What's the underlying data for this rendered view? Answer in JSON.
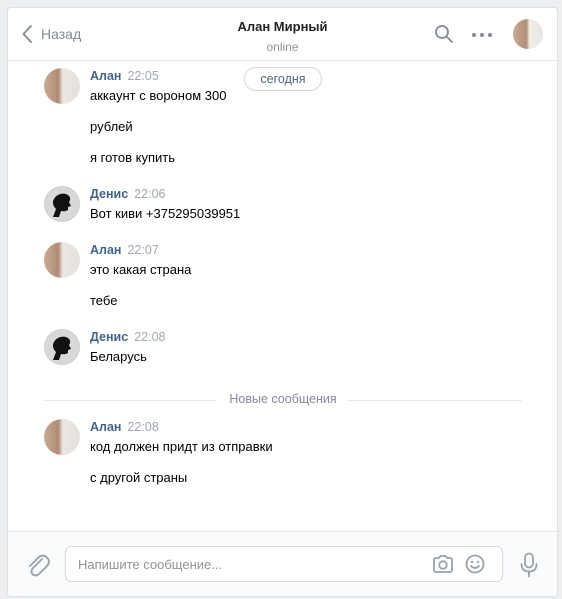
{
  "header": {
    "back_label": "Назад",
    "peer_name": "Алан Мирный",
    "peer_status": "online"
  },
  "date_pill": "сегодня",
  "messages": [
    {
      "author": "Алан",
      "time": "22:05",
      "avatar": "alan-avatar",
      "lines": [
        "аккаунт с вороном 300",
        "рублей",
        "я готов купить"
      ]
    },
    {
      "author": "Денис",
      "time": "22:06",
      "avatar": "denis-avatar",
      "lines": [
        "Вот киви +375295039951"
      ]
    },
    {
      "author": "Алан",
      "time": "22:07",
      "avatar": "alan-avatar",
      "lines": [
        "это какая страна",
        "тебе"
      ]
    },
    {
      "author": "Денис",
      "time": "22:08",
      "avatar": "denis-avatar",
      "lines": [
        "Беларусь"
      ]
    },
    {
      "author": "Алан",
      "time": "22:08",
      "avatar": "alan-avatar",
      "lines": [
        "код должен придт из отправки",
        "с другой страны"
      ]
    }
  ],
  "new_messages_label": "Новые сообщения",
  "composer": {
    "placeholder": "Напишите сообщение...",
    "value": ""
  },
  "icons": [
    "back-chevron-icon",
    "search-icon",
    "more-dots-icon",
    "paperclip-icon",
    "camera-icon",
    "smile-icon",
    "microphone-icon"
  ],
  "colors": {
    "author": "#42648b",
    "muted": "#828a99",
    "border": "#d3d9de"
  }
}
